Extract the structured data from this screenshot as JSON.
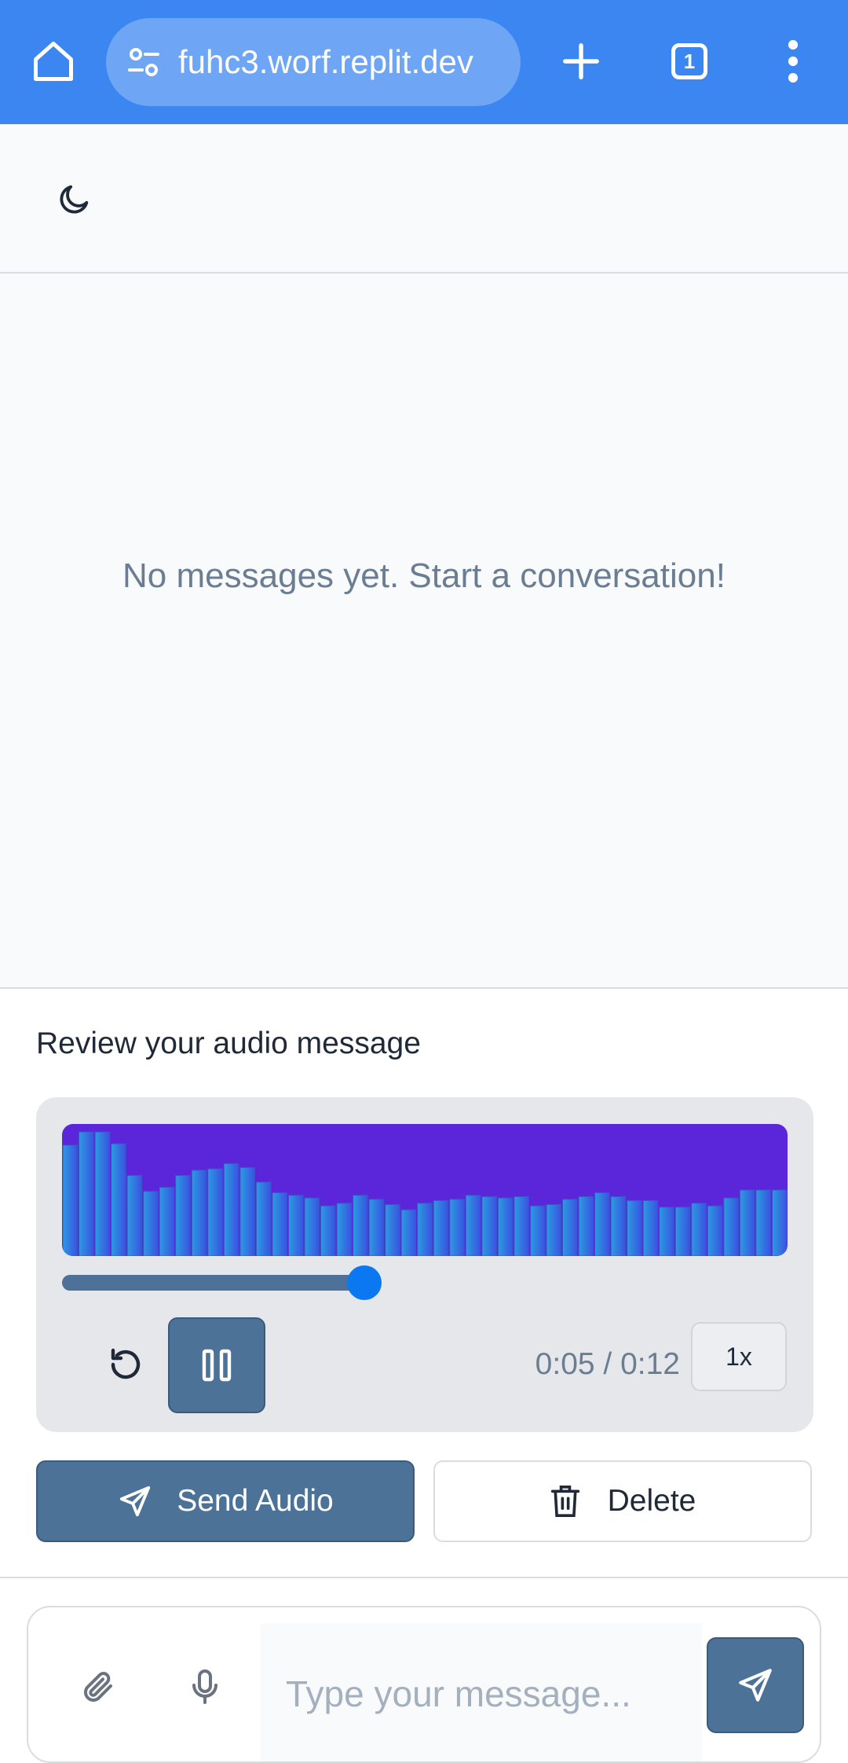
{
  "browser": {
    "url": "fuhc3.worf.replit.dev",
    "tab_count": "1",
    "icons": [
      "home-icon",
      "site-settings-icon",
      "plus-icon",
      "tabs-icon",
      "menu-icon"
    ]
  },
  "header": {
    "theme_icon": "moon-icon"
  },
  "messages": {
    "empty_text": "No messages yet. Start a conversation!"
  },
  "review": {
    "title": "Review your audio message",
    "player": {
      "progress": 0.4167,
      "time": "0:05 / 0:12",
      "speed": "1x",
      "waveform_levels": [
        0.84,
        0.94,
        0.94,
        0.85,
        0.61,
        0.49,
        0.52,
        0.61,
        0.65,
        0.66,
        0.7,
        0.67,
        0.56,
        0.48,
        0.46,
        0.44,
        0.38,
        0.4,
        0.46,
        0.43,
        0.39,
        0.35,
        0.4,
        0.42,
        0.43,
        0.46,
        0.45,
        0.44,
        0.45,
        0.38,
        0.39,
        0.43,
        0.45,
        0.48,
        0.45,
        0.42,
        0.42,
        0.37,
        0.37,
        0.4,
        0.38,
        0.44,
        0.5,
        0.5,
        0.5
      ],
      "colors": {
        "waveform_bg": "#5b26d9",
        "bar_start": "#2b9be0",
        "bar_end": "#3a52e2",
        "seek": "#4d7198",
        "thumb": "#0b78f2"
      }
    },
    "send_label": "Send Audio",
    "delete_label": "Delete"
  },
  "composer": {
    "placeholder": "Type your message..."
  },
  "colors": {
    "accent": "#4c7298",
    "browser_bar": "#3b86f1"
  }
}
